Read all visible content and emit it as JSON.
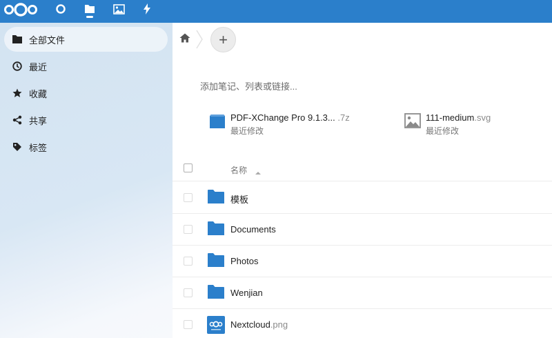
{
  "header": {
    "apps": [
      {
        "icon": "nextcloud-logo"
      },
      {
        "icon": "dashboard-circle-icon"
      },
      {
        "icon": "files-folder-icon",
        "active": true
      },
      {
        "icon": "photos-image-icon"
      },
      {
        "icon": "activity-lightning-icon"
      }
    ],
    "color": "#2b7fcb"
  },
  "sidebar": {
    "items": [
      {
        "label": "全部文件",
        "icon": "folder-icon",
        "active": true
      },
      {
        "label": "最近",
        "icon": "clock-icon"
      },
      {
        "label": "收藏",
        "icon": "star-icon"
      },
      {
        "label": "共享",
        "icon": "share-icon"
      },
      {
        "label": "标签",
        "icon": "tag-icon"
      }
    ]
  },
  "main": {
    "breadcrumb": {
      "home_icon": "home-icon",
      "add_label": "+"
    },
    "note_placeholder": "添加笔记、列表或链接...",
    "recent": [
      {
        "name": "PDF-XChange Pro 9.1.3...",
        "ext": ".7z",
        "subtitle": "最近修改",
        "icon": "archive-file-icon"
      },
      {
        "name": "111-medium",
        "ext": ".svg",
        "subtitle": "最近修改",
        "icon": "image-file-icon"
      }
    ],
    "list": {
      "column_name": "名称",
      "rows": [
        {
          "name": "模板",
          "ext": "",
          "type": "folder"
        },
        {
          "name": "Documents",
          "ext": "",
          "type": "folder"
        },
        {
          "name": "Photos",
          "ext": "",
          "type": "folder"
        },
        {
          "name": "Wenjian",
          "ext": "",
          "type": "folder"
        },
        {
          "name": "Nextcloud",
          "ext": ".png",
          "type": "image"
        }
      ]
    }
  }
}
